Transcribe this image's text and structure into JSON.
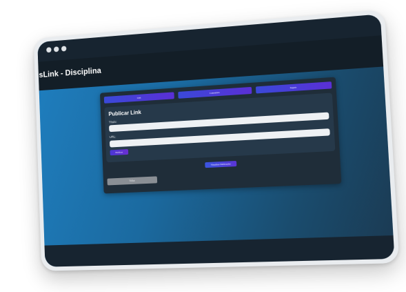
{
  "window": {
    "controls": [
      "dot-1",
      "dot-2",
      "dot-3"
    ]
  },
  "header": {
    "title": "pusLink - Disciplina"
  },
  "tabs": [
    {
      "label": "Link"
    },
    {
      "label": "Comentário"
    },
    {
      "label": "Sugerir"
    }
  ],
  "form": {
    "title": "Publicar Link",
    "title_label": "Título:",
    "title_value": "",
    "url_label": "URL:",
    "url_value": "",
    "publish_label": "Publicar"
  },
  "actions": {
    "view_posts_label": "Visualizar Publicações",
    "back_label": "Voltar"
  },
  "colors": {
    "accent_gradient_start": "#3a49d8",
    "accent_gradient_end": "#5a2fd6",
    "panel_bg": "#1f2d39",
    "card_bg": "#26394a",
    "topbar_bg": "#172430"
  }
}
